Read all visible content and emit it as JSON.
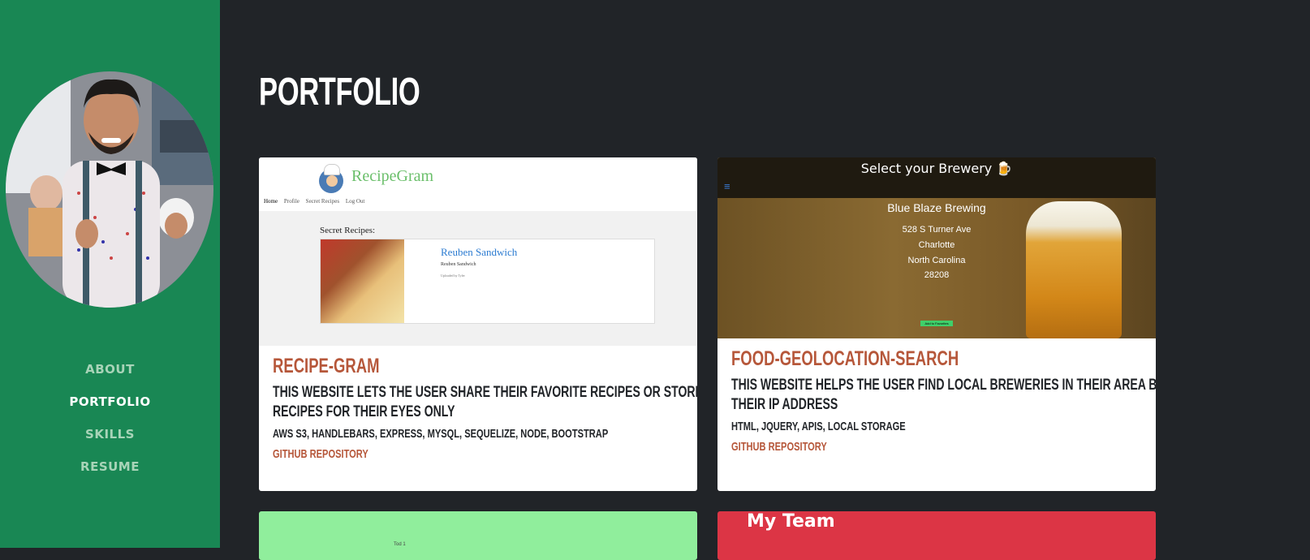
{
  "nav": {
    "items": [
      {
        "label": "ABOUT",
        "active": false
      },
      {
        "label": "PORTFOLIO",
        "active": true
      },
      {
        "label": "SKILLS",
        "active": false
      },
      {
        "label": "RESUME",
        "active": false
      }
    ]
  },
  "page": {
    "title": "PORTFOLIO"
  },
  "projects": [
    {
      "title": "RECIPE-GRAM",
      "description_lines": [
        "THIS WEBSITE LETS THE USER SHARE THEIR FAVORITE RECIPES OR STORE SECRET",
        "RECIPES FOR THEIR EYES ONLY"
      ],
      "tech": "AWS S3, HANDLEBARS, EXPRESS, MYSQL, SEQUELIZE, NODE, BOOTSTRAP",
      "link": "GITHUB REPOSITORY",
      "preview": {
        "brand": "RecipeGram",
        "nav": [
          "Home",
          "Profile",
          "Secret Recipes",
          "Log Out"
        ],
        "section": "Secret Recipes:",
        "dish": "Reuben Sandwich",
        "dish_sub": "Reuben Sandwich",
        "uploaded": "Uploaded by Tyler"
      }
    },
    {
      "title": "FOOD-GEOLOCATION-SEARCH",
      "description_lines": [
        "THIS WEBSITE HELPS THE USER FIND LOCAL BREWERIES IN THEIR AREA BY USING",
        "THEIR IP ADDRESS"
      ],
      "tech": "HTML, JQUERY, APIS, LOCAL STORAGE",
      "link": "GITHUB REPOSITORY",
      "preview": {
        "header": "Select your Brewery 🍺",
        "menu": "≡",
        "name": "Blue Blaze Brewing",
        "street": "528 S Turner Ave",
        "city": "Charlotte",
        "state": "North Carolina",
        "zip": "28208",
        "button": "Add to Favorites"
      }
    }
  ],
  "bottom_cards": {
    "team_title": "My Team",
    "green_card_text": "Tod 1"
  },
  "colors": {
    "sidebar": "#198754",
    "background": "#212428",
    "accent": "#b6573a"
  }
}
